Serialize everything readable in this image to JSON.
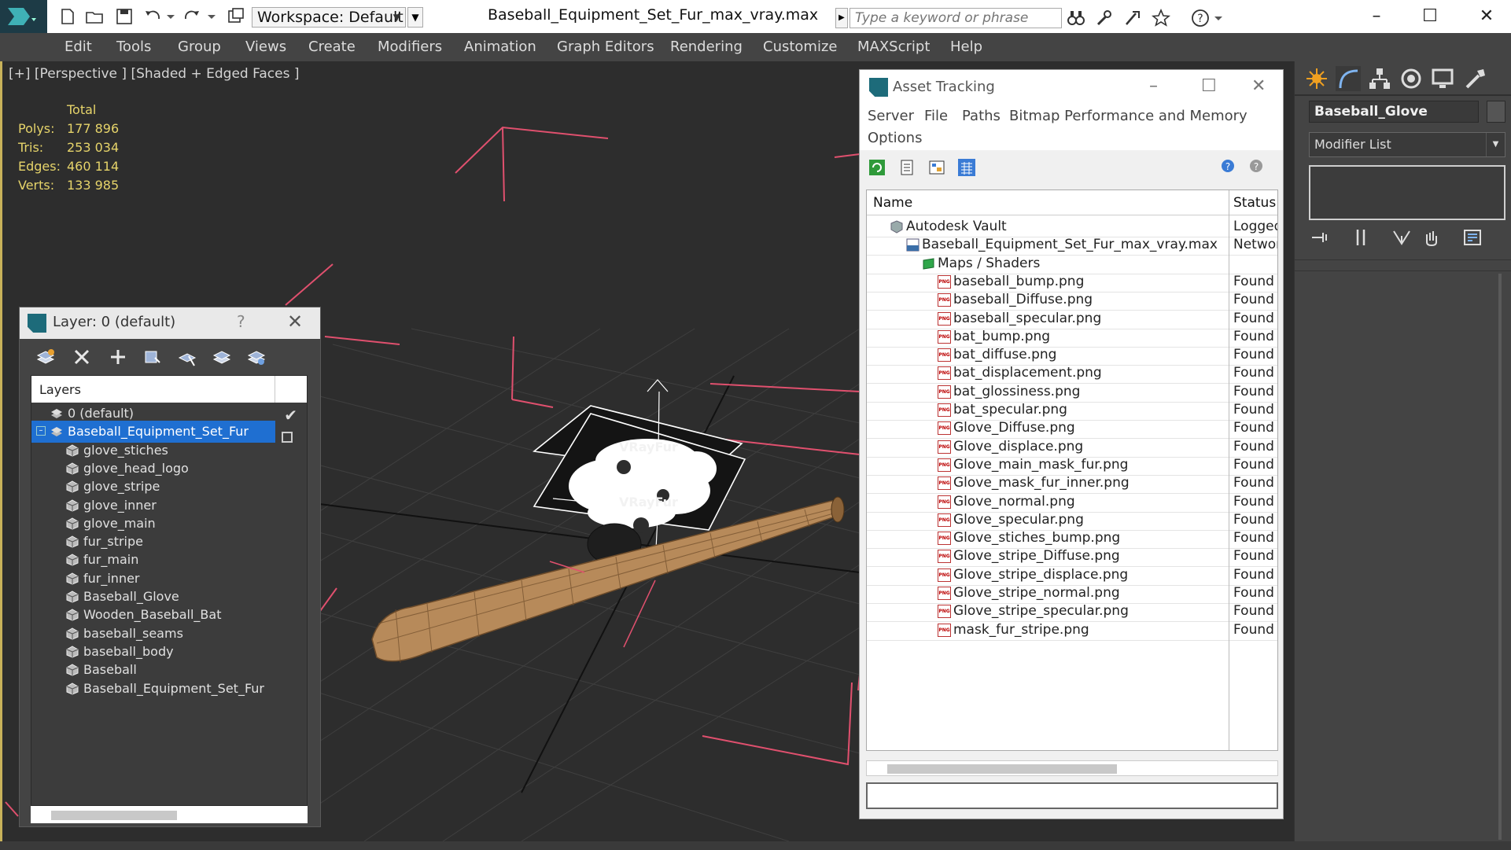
{
  "titlebar": {
    "file_title": "Baseball_Equipment_Set_Fur_max_vray.max",
    "workspace": "Workspace: Default",
    "search_placeholder": "Type a keyword or phrase",
    "icons": [
      "new-icon",
      "open-icon",
      "save-icon",
      "undo-icon",
      "redo-icon",
      "project-icon",
      "binoculars-icon",
      "tools-icon",
      "star-icon",
      "help-icon"
    ]
  },
  "menu": [
    "Edit",
    "Tools",
    "Group",
    "Views",
    "Create",
    "Modifiers",
    "Animation",
    "Graph Editors",
    "Rendering",
    "Customize",
    "MAXScript",
    "Help"
  ],
  "viewport": {
    "label": "[+] [Perspective ] [Shaded + Edged Faces ]",
    "stats": {
      "title": "Total",
      "rows": [
        {
          "k": "Polys:",
          "v": "177 896"
        },
        {
          "k": "Tris:",
          "v": "253 034"
        },
        {
          "k": "Edges:",
          "v": "460 114"
        },
        {
          "k": "Verts:",
          "v": "133 985"
        }
      ]
    },
    "fur_labels": [
      "VRayFur",
      "VRayFur"
    ]
  },
  "layer_dialog": {
    "title": "Layer: 0 (default)",
    "help": "?",
    "header": "Layers",
    "rows": [
      {
        "label": "0 (default)",
        "level": 1,
        "selected": false
      },
      {
        "label": "Baseball_Equipment_Set_Fur",
        "level": 1,
        "selected": true
      },
      {
        "label": "glove_stiches",
        "level": 2
      },
      {
        "label": "glove_head_logo",
        "level": 2
      },
      {
        "label": "glove_stripe",
        "level": 2
      },
      {
        "label": "glove_inner",
        "level": 2
      },
      {
        "label": "glove_main",
        "level": 2
      },
      {
        "label": "fur_stripe",
        "level": 2
      },
      {
        "label": "fur_main",
        "level": 2
      },
      {
        "label": "fur_inner",
        "level": 2
      },
      {
        "label": "Baseball_Glove",
        "level": 2
      },
      {
        "label": "Wooden_Baseball_Bat",
        "level": 2
      },
      {
        "label": "baseball_seams",
        "level": 2
      },
      {
        "label": "baseball_body",
        "level": 2
      },
      {
        "label": "Baseball",
        "level": 2
      },
      {
        "label": "Baseball_Equipment_Set_Fur",
        "level": 2
      }
    ]
  },
  "asset_dialog": {
    "title": "Asset Tracking",
    "menu": [
      "Server",
      "File",
      "Paths",
      "Bitmap Performance and Memory",
      "Options"
    ],
    "col_name": "Name",
    "col_status": "Status",
    "rows": [
      {
        "name": "Autodesk Vault",
        "status": "Logged",
        "indent": 1,
        "icon": "vault-icon"
      },
      {
        "name": "Baseball_Equipment_Set_Fur_max_vray.max",
        "status": "Network",
        "indent": 2,
        "icon": "max-file-icon"
      },
      {
        "name": "Maps / Shaders",
        "status": "",
        "indent": 3,
        "icon": "maps-icon"
      },
      {
        "name": "baseball_bump.png",
        "status": "Found",
        "indent": 4,
        "icon": "png-icon"
      },
      {
        "name": "baseball_Diffuse.png",
        "status": "Found",
        "indent": 4,
        "icon": "png-icon"
      },
      {
        "name": "baseball_specular.png",
        "status": "Found",
        "indent": 4,
        "icon": "png-icon"
      },
      {
        "name": "bat_bump.png",
        "status": "Found",
        "indent": 4,
        "icon": "png-icon"
      },
      {
        "name": "bat_diffuse.png",
        "status": "Found",
        "indent": 4,
        "icon": "png-icon"
      },
      {
        "name": "bat_displacement.png",
        "status": "Found",
        "indent": 4,
        "icon": "png-icon"
      },
      {
        "name": "bat_glossiness.png",
        "status": "Found",
        "indent": 4,
        "icon": "png-icon"
      },
      {
        "name": "bat_specular.png",
        "status": "Found",
        "indent": 4,
        "icon": "png-icon"
      },
      {
        "name": "Glove_Diffuse.png",
        "status": "Found",
        "indent": 4,
        "icon": "png-icon"
      },
      {
        "name": "Glove_displace.png",
        "status": "Found",
        "indent": 4,
        "icon": "png-icon"
      },
      {
        "name": "Glove_main_mask_fur.png",
        "status": "Found",
        "indent": 4,
        "icon": "png-icon"
      },
      {
        "name": "Glove_mask_fur_inner.png",
        "status": "Found",
        "indent": 4,
        "icon": "png-icon"
      },
      {
        "name": "Glove_normal.png",
        "status": "Found",
        "indent": 4,
        "icon": "png-icon"
      },
      {
        "name": "Glove_specular.png",
        "status": "Found",
        "indent": 4,
        "icon": "png-icon"
      },
      {
        "name": "Glove_stiches_bump.png",
        "status": "Found",
        "indent": 4,
        "icon": "png-icon"
      },
      {
        "name": "Glove_stripe_Diffuse.png",
        "status": "Found",
        "indent": 4,
        "icon": "png-icon"
      },
      {
        "name": "Glove_stripe_displace.png",
        "status": "Found",
        "indent": 4,
        "icon": "png-icon"
      },
      {
        "name": "Glove_stripe_normal.png",
        "status": "Found",
        "indent": 4,
        "icon": "png-icon"
      },
      {
        "name": "Glove_stripe_specular.png",
        "status": "Found",
        "indent": 4,
        "icon": "png-icon"
      },
      {
        "name": "mask_fur_stripe.png",
        "status": "Found",
        "indent": 4,
        "icon": "png-icon"
      }
    ]
  },
  "command_panel": {
    "object_name": "Baseball_Glove",
    "modifier_list": "Modifier List",
    "tabs": [
      "create-tab-icon",
      "modify-tab-icon",
      "hierarchy-tab-icon",
      "motion-tab-icon",
      "display-tab-icon",
      "utilities-tab-icon"
    ]
  },
  "colors": {
    "accent": "#1f6fd1",
    "stats_text": "#e6d46a",
    "viewport_bg": "#2d2d2d",
    "panel_bg": "#444444",
    "selection_pink": "#e0506e"
  }
}
